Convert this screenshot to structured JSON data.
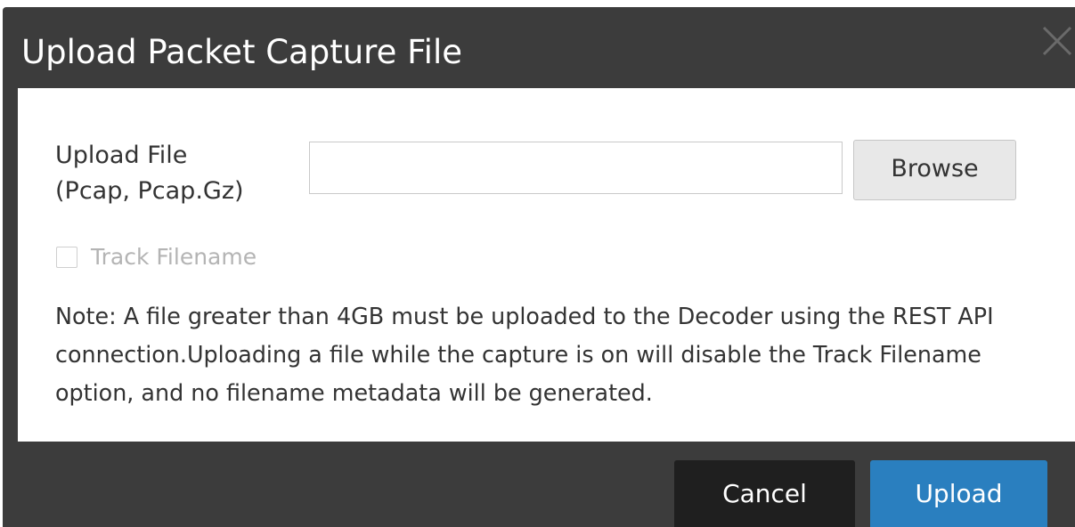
{
  "dialog": {
    "title": "Upload Packet Capture File",
    "close_icon": "close-icon"
  },
  "form": {
    "upload_label_line1": "Upload File",
    "upload_label_line2": "(Pcap, Pcap.Gz)",
    "file_value": "",
    "browse_label": "Browse",
    "track_filename_label": "Track Filename",
    "track_filename_checked": false,
    "note": "Note: A file greater than 4GB must be uploaded to the Decoder using the REST API connection.Uploading a file while the capture is on will disable the Track Filename option, and no filename metadata will be generated."
  },
  "footer": {
    "cancel_label": "Cancel",
    "upload_label": "Upload"
  },
  "colors": {
    "dialog_chrome": "#3c3c3c",
    "cancel_bg": "#1f1f1f",
    "upload_bg": "#2a7fbf",
    "disabled_text": "#b4b4b4"
  }
}
